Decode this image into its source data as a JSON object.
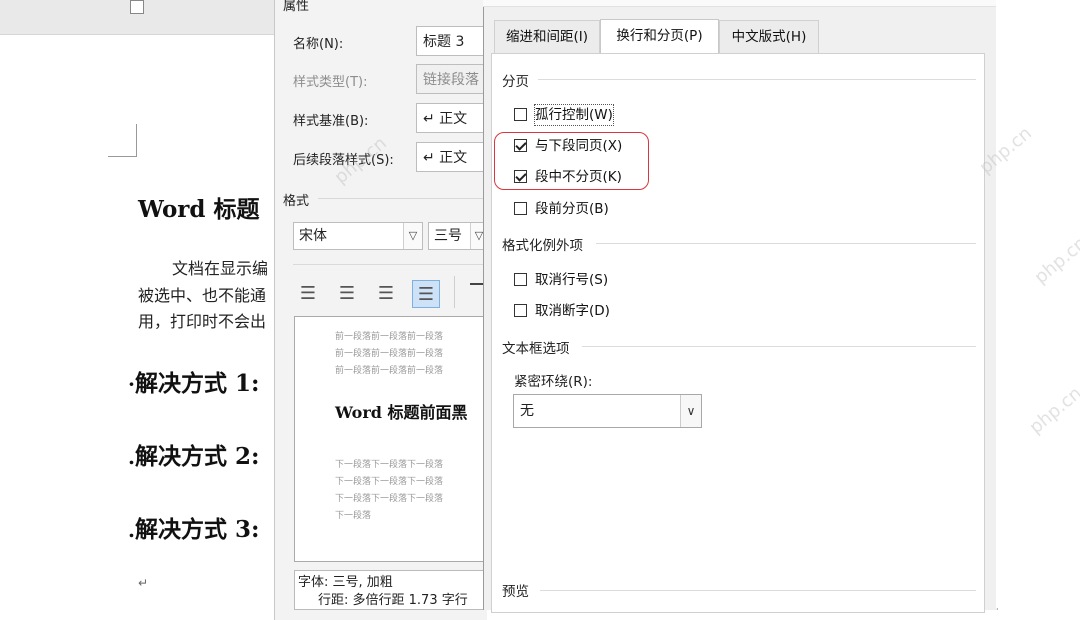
{
  "document": {
    "heading": "Word 标题",
    "paragraph_lines": [
      "文档在显示编",
      "被选中、也不能通",
      "用，打印时不会出"
    ],
    "bullets": [
      "解决方式 1:",
      "解决方式 2:",
      "解决方式 3:"
    ],
    "para_mark": "↵"
  },
  "style_dialog": {
    "section_properties": "属性",
    "name_label": "名称(N):",
    "name_value": "标题 3",
    "type_label": "样式类型(T):",
    "type_value": "链接段落",
    "based_label": "样式基准(B):",
    "based_value": "↵ 正文",
    "next_label": "后续段落样式(S):",
    "next_value": "↵ 正文",
    "section_format": "格式",
    "font_value": "宋体",
    "size_value": "三号",
    "align_icons": [
      "align-left-icon",
      "align-center-icon",
      "align-right-icon",
      "align-justify-icon"
    ],
    "align_glyphs": [
      "☰",
      "☰",
      "☰",
      "☰"
    ],
    "preview_prev_lines": [
      "前一段落前一段落前一段落",
      "前一段落前一段落前一段落",
      "前一段落前一段落前一段落"
    ],
    "preview_main": "Word 标题前面黑",
    "preview_next_lines": [
      "下一段落下一段落下一段落",
      "下一段落下一段落下一段落",
      "下一段落下一段落下一段落",
      "下一段落"
    ],
    "desc_line1": "字体: 三号, 加粗",
    "desc_line2": "行距: 多倍行距 1.73 字行"
  },
  "paragraph_dialog": {
    "tabs": [
      {
        "label": "缩进和间距(I)",
        "selected": false
      },
      {
        "label": "换行和分页(P)",
        "selected": true
      },
      {
        "label": "中文版式(H)",
        "selected": false
      }
    ],
    "group_pagination": "分页",
    "checks_pagination": [
      {
        "label": "孤行控制(W)",
        "checked": false
      },
      {
        "label": "与下段同页(X)",
        "checked": true
      },
      {
        "label": "段中不分页(K)",
        "checked": true
      },
      {
        "label": "段前分页(B)",
        "checked": false
      }
    ],
    "group_exceptions": "格式化例外项",
    "checks_exceptions": [
      {
        "label": "取消行号(S)",
        "checked": false
      },
      {
        "label": "取消断字(D)",
        "checked": false
      }
    ],
    "group_textbox": "文本框选项",
    "wrap_label": "紧密环绕(R):",
    "wrap_value": "无",
    "group_preview": "预览"
  },
  "watermark": "php.cn",
  "colors": {
    "highlight": "#d9363e",
    "selected_align": "#cde2f6"
  }
}
